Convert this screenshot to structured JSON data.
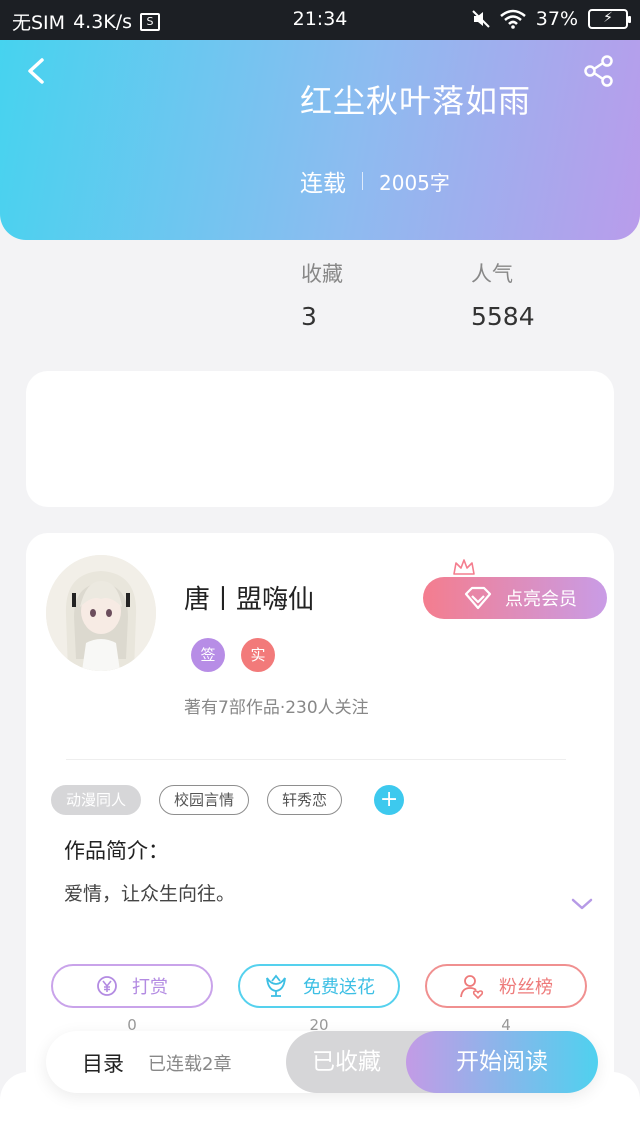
{
  "status_bar": {
    "carrier": "无SIM",
    "speed": "4.3K/s",
    "time": "21:34",
    "battery": "37%"
  },
  "header": {
    "title": "红尘秋叶落如雨",
    "status": "连载",
    "word_count": "2005字"
  },
  "stats": [
    {
      "label": "收藏",
      "value": "3"
    },
    {
      "label": "人气",
      "value": "5584"
    }
  ],
  "author": {
    "name": "唐丨盟嗨仙",
    "badge_sign": "签",
    "badge_real": "实",
    "summary": "著有7部作品·230人关注",
    "vip_label": "点亮会员"
  },
  "tags": [
    "动漫同人",
    "校园言情",
    "轩秀恋"
  ],
  "intro": {
    "title": "作品简介：",
    "text": "爱情，让众生向往。"
  },
  "actions": [
    {
      "label": "打赏",
      "count": "0"
    },
    {
      "label": "免费送花",
      "count": "20"
    },
    {
      "label": "粉丝榜",
      "count": "4"
    }
  ],
  "bottom": {
    "toc": "目录",
    "chapters": "已连载2章",
    "collected": "已收藏",
    "read": "开始阅读"
  },
  "colors": {
    "header_start": "#46d3ef",
    "header_end": "#b99ceb",
    "accent_blue": "#3dc9ee",
    "accent_purple": "#b78de6",
    "accent_red": "#f27a7a"
  }
}
